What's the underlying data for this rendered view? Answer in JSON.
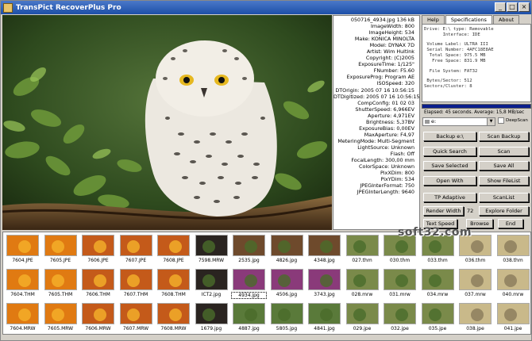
{
  "app": {
    "title": "TransPict RecoverPlus Pro"
  },
  "exif": [
    "050716_4934.jpg  136 kB",
    "ImageWidth: 800",
    "ImageHeight: 534",
    "Make: KONICA MINOLTA",
    "Model: DYNAX 7D",
    "Artist: Wim Hultink",
    "Copyright: (C)2005",
    "ExposureTime: 1/125\"",
    "FNumber: F5.60",
    "ExposureProg: Program AE",
    "ISOSpeed: 320",
    "DTOrigin: 2005 07 16 10:56:15",
    "DTDigitized: 2005 07 16 10:56:15",
    "CompConfig: 01 02 03",
    "ShutterSpeed: 6,966EV",
    "Aperture: 4,971EV",
    "Brightness: 5,37BV",
    "ExposureBias: 0,00EV",
    "MaxAperture: F4,97",
    "MeteringMode: Multi-Segment",
    "LightSource: Unknown",
    "Flash: Off",
    "FocalLength: 300,00 mm",
    "ColorSpace: Unknown",
    "PixXDim: 800",
    "PixYDim: 534",
    "JPEGInterFormat: 750",
    "JPEGInterLength: 9640"
  ],
  "tabs": [
    "Help",
    "Specifications",
    "About"
  ],
  "specs": [
    "Drive: E:\\ type: Removable",
    "       Interface: IDE",
    "",
    " Volume Label: ULTRA III",
    " Serial Number: 4AFC18E8AE",
    "  Total Space: 975.5 MB",
    "   Free Space: 831.9 MB",
    "",
    "  File System: FAT32",
    "",
    " Bytes/Sector: 512",
    "Sectors/Cluster: 8"
  ],
  "elapsed": "Elapsed: 45 seconds. Average: 15,8 MB/sec",
  "drive": {
    "value": "e:"
  },
  "deepscan": "DeepScan",
  "buttons": {
    "backup": "Backup e:\\",
    "scan_backup": "Scan Backup",
    "quick_search": "Quick Search",
    "scan": "Scan",
    "save_selected": "Save Selected",
    "save_all": "Save All",
    "open_with": "Open With",
    "show_filelist": "Show FileList",
    "tp_adaptive": "TP Adaptive",
    "scanlist": "ScanList",
    "render_width": "Render Width",
    "explore_folder": "Explore Folder",
    "text_speed": "Text Speed",
    "browse": "Browse",
    "end": "End"
  },
  "render_width_value": "72",
  "watermark": "soft32.com",
  "thumbnails": [
    [
      "7604.JPE",
      "7605.JPE",
      "7606.JPE",
      "7607.JPE",
      "7608.JPE",
      "7598.MRW",
      "2535.jpg",
      "4826.jpg",
      "4348.jpg",
      "027.thm",
      "030.thm",
      "033.thm",
      "036.thm",
      "038.thm"
    ],
    [
      "7604.THM",
      "7605.THM",
      "7606.THM",
      "7607.THM",
      "7608.THM",
      "ICT2.jpg",
      "4934.jpg",
      "4506.jpg",
      "3743.jpg",
      "028.mrw",
      "031.mrw",
      "034.mrw",
      "037.mrw",
      "040.mrw"
    ],
    [
      "7604.MRW",
      "7605.MRW",
      "7606.MRW",
      "7607.MRW",
      "7608.MRW",
      "1679.jpg",
      "4887.jpg",
      "5805.jpg",
      "4841.jpg",
      "029.jpe",
      "032.jpe",
      "035.jpe",
      "038.jpe",
      "041.jpe"
    ]
  ],
  "thumb_colors": {
    "flower_bright": "#e07a12",
    "flower_dark": "#c45a1a",
    "leaf": "#3f6b2a",
    "dark": "#2a2420",
    "stone": "#c9b98a"
  }
}
